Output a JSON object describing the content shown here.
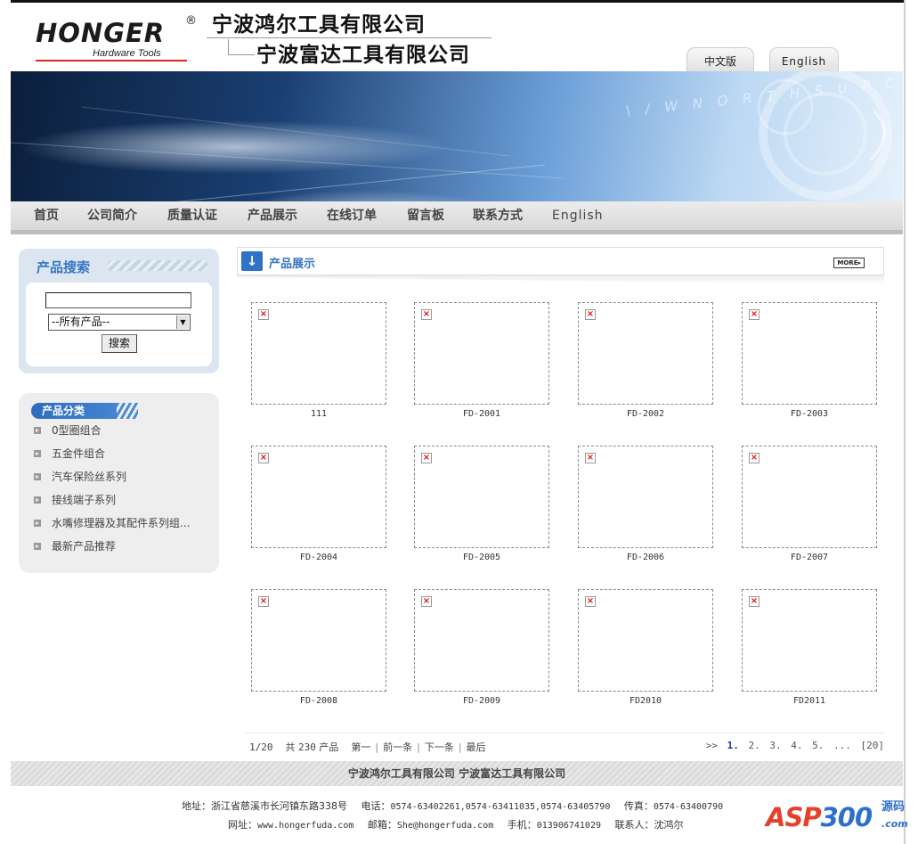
{
  "header": {
    "logo_text": "HONGER",
    "logo_registered": "®",
    "logo_subtitle": "Hardware Tools",
    "company_name_1": "宁波鸿尔工具有限公司",
    "company_name_2": "宁波富达工具有限公司",
    "lang_cn": "中文版",
    "lang_en": "English"
  },
  "banner": {
    "decor_text": "\\ / W  N O R T H S U P C M"
  },
  "nav": {
    "items": [
      "首页",
      "公司简介",
      "质量认证",
      "产品展示",
      "在线订单",
      "留言板",
      "联系方式",
      "English"
    ]
  },
  "search_panel": {
    "title": "产品搜索",
    "input_value": "",
    "select_value": "--所有产品--",
    "button_label": "搜索"
  },
  "category_panel": {
    "title": "产品分类",
    "items": [
      "0型圈组合",
      "五金件组合",
      "汽车保险丝系列",
      "接线端子系列",
      "水嘴修理器及其配件系列组...",
      "最新产品推荐"
    ]
  },
  "content": {
    "title": "产品展示",
    "more_label": "MORE▸",
    "products": [
      "111",
      "FD-2001",
      "FD-2002",
      "FD-2003",
      "FD-2004",
      "FD-2005",
      "FD-2006",
      "FD-2007",
      "FD-2008",
      "FD-2009",
      "FD2010",
      "FD2011"
    ]
  },
  "pager": {
    "position": "1/20",
    "total_prefix": "共",
    "total": "230",
    "total_suffix": "产品",
    "first": "第一",
    "prev": "前一条",
    "next": "下一条",
    "last": "最后",
    "arrows": ">>",
    "pages": [
      "1.",
      "2.",
      "3.",
      "4.",
      "5.",
      "..."
    ],
    "total_pages": "[20]"
  },
  "footer": {
    "companies": "宁波鸿尔工具有限公司  宁波富达工具有限公司",
    "address_label": "地址：",
    "address": "浙江省慈溪市长河镇东路338号",
    "phone_label": "电话：",
    "phone": "0574-63402261,0574-63411035,0574-63405790",
    "fax_label": "传真：",
    "fax": "0574-63400790",
    "web_label": "网址：",
    "web": "www.hongerfuda.com",
    "email_label": "邮箱：",
    "email": "She@hongerfuda.com",
    "mobile_label": "手机：",
    "mobile": "013906741029",
    "contact_label": "联系人：",
    "contact": "沈鸿尔"
  },
  "watermark": {
    "text_red": "ASP",
    "text_blue": "300",
    "side_text": "源码",
    "domain": ".com"
  },
  "colors": {
    "accent_blue": "#3676c2",
    "nav_bg": "#dcdcdc",
    "panel_blue": "#dbe6f1"
  }
}
